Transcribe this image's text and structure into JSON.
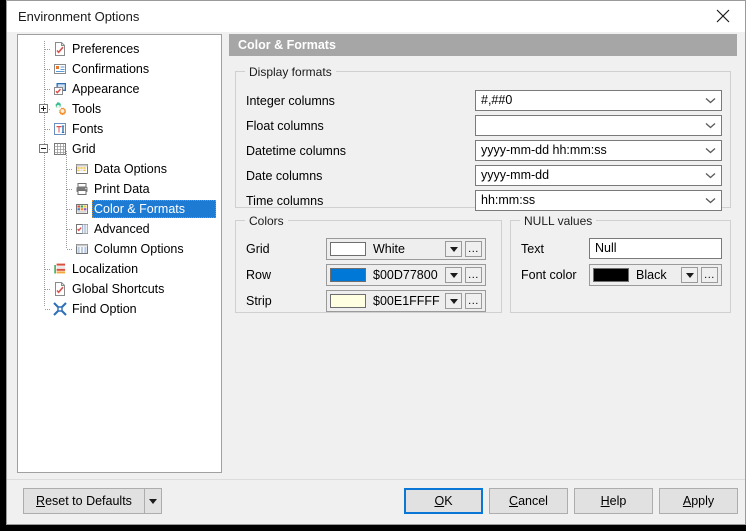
{
  "window": {
    "title": "Environment Options",
    "close_icon": "close-icon"
  },
  "tree": {
    "items": [
      {
        "label": "Preferences",
        "icon": "preferences-icon",
        "level": 1,
        "expander": "none"
      },
      {
        "label": "Confirmations",
        "icon": "confirmations-icon",
        "level": 1,
        "expander": "none"
      },
      {
        "label": "Appearance",
        "icon": "appearance-icon",
        "level": 1,
        "expander": "none"
      },
      {
        "label": "Tools",
        "icon": "tools-icon",
        "level": 1,
        "expander": "plus"
      },
      {
        "label": "Fonts",
        "icon": "fonts-icon",
        "level": 1,
        "expander": "none"
      },
      {
        "label": "Grid",
        "icon": "grid-icon",
        "level": 1,
        "expander": "minus"
      },
      {
        "label": "Data Options",
        "icon": "data-options-icon",
        "level": 2,
        "expander": "none"
      },
      {
        "label": "Print Data",
        "icon": "print-data-icon",
        "level": 2,
        "expander": "none"
      },
      {
        "label": "Color & Formats",
        "icon": "color-formats-icon",
        "level": 2,
        "expander": "none",
        "selected": true
      },
      {
        "label": "Advanced",
        "icon": "advanced-icon",
        "level": 2,
        "expander": "none"
      },
      {
        "label": "Column Options",
        "icon": "column-options-icon",
        "level": 2,
        "expander": "none"
      },
      {
        "label": "Localization",
        "icon": "localization-icon",
        "level": 1,
        "expander": "none"
      },
      {
        "label": "Global Shortcuts",
        "icon": "global-shortcuts-icon",
        "level": 1,
        "expander": "none"
      },
      {
        "label": "Find Option",
        "icon": "find-option-icon",
        "level": 1,
        "expander": "none"
      }
    ]
  },
  "content": {
    "header": "Color & Formats",
    "display_formats": {
      "title": "Display formats",
      "fields": [
        {
          "label": "Integer columns",
          "value": "#,##0"
        },
        {
          "label": "Float columns",
          "value": ""
        },
        {
          "label": "Datetime columns",
          "value": "yyyy-mm-dd hh:mm:ss"
        },
        {
          "label": "Date columns",
          "value": "yyyy-mm-dd"
        },
        {
          "label": "Time columns",
          "value": "hh:mm:ss"
        }
      ]
    },
    "colors": {
      "title": "Colors",
      "rows": [
        {
          "label": "Grid",
          "value": "White",
          "swatch": "#ffffff"
        },
        {
          "label": "Row",
          "value": "$00D77800",
          "swatch": "#0078d7"
        },
        {
          "label": "Strip",
          "value": "$00E1FFFF",
          "swatch": "#ffffe1"
        }
      ],
      "ellipsis_label": "..."
    },
    "null_values": {
      "title": "NULL values",
      "text_label": "Text",
      "text_value": "Null",
      "font_color_label": "Font color",
      "font_color_value": "Black",
      "font_color_swatch": "#000000",
      "ellipsis_label": "..."
    }
  },
  "footer": {
    "reset": {
      "pre": "R",
      "post": "eset to Defaults"
    },
    "ok": {
      "pre": "O",
      "post": "K"
    },
    "cancel": {
      "pre": "C",
      "post": "ancel"
    },
    "help": {
      "pre": "H",
      "post": "elp"
    },
    "apply": {
      "pre": "A",
      "post": "pply"
    }
  }
}
